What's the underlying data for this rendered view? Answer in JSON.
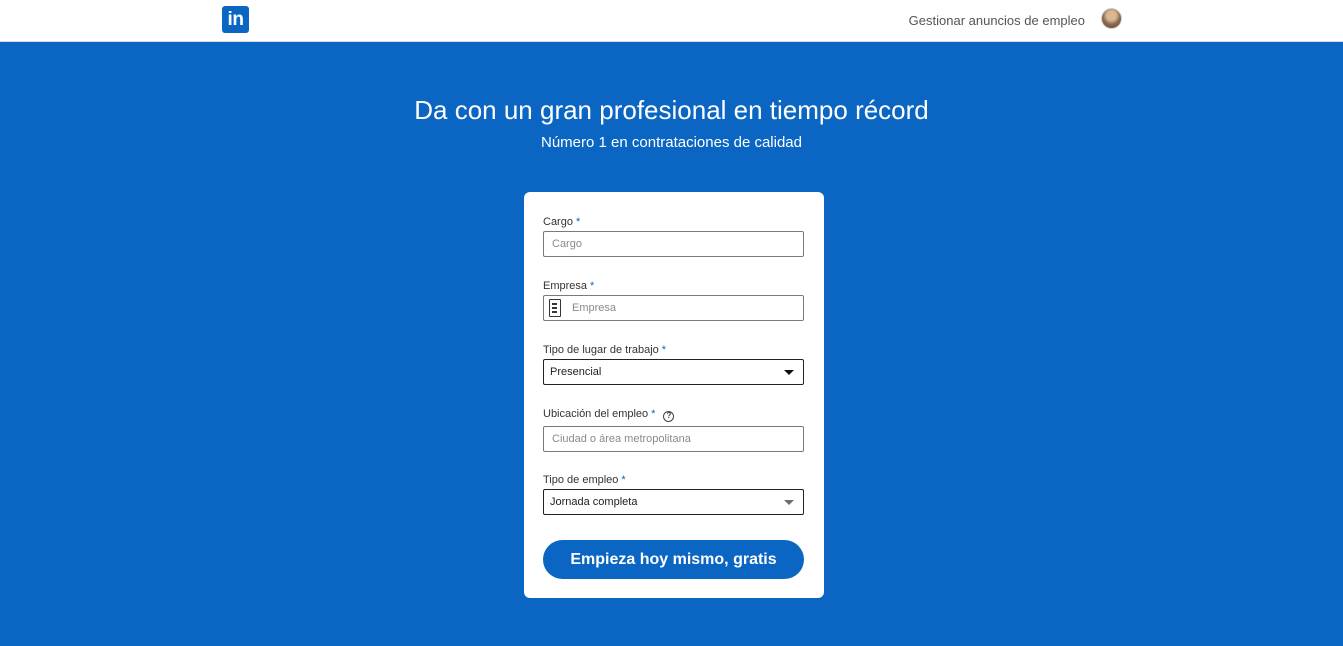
{
  "header": {
    "logo_text": "in",
    "manage_jobs_link": "Gestionar anuncios de empleo"
  },
  "hero": {
    "title": "Da con un gran profesional en tiempo récord",
    "subtitle": "Número 1 en contrataciones de calidad"
  },
  "form": {
    "required_mark": "*",
    "help_icon_glyph": "?",
    "job_title": {
      "label": "Cargo",
      "placeholder": "Cargo"
    },
    "company": {
      "label": "Empresa",
      "placeholder": "Empresa",
      "icon": "building-icon"
    },
    "workplace_type": {
      "label": "Tipo de lugar de trabajo",
      "selected": "Presencial"
    },
    "job_location": {
      "label": "Ubicación del empleo",
      "placeholder": "Ciudad o área metropolitana",
      "icon": "help-circle-icon"
    },
    "employment_type": {
      "label": "Tipo de empleo",
      "selected": "Jornada completa"
    },
    "submit_label": "Empieza hoy mismo, gratis"
  },
  "colors": {
    "brand_blue": "#0a66c2",
    "header_bg": "#ffffff",
    "card_bg": "#ffffff"
  }
}
